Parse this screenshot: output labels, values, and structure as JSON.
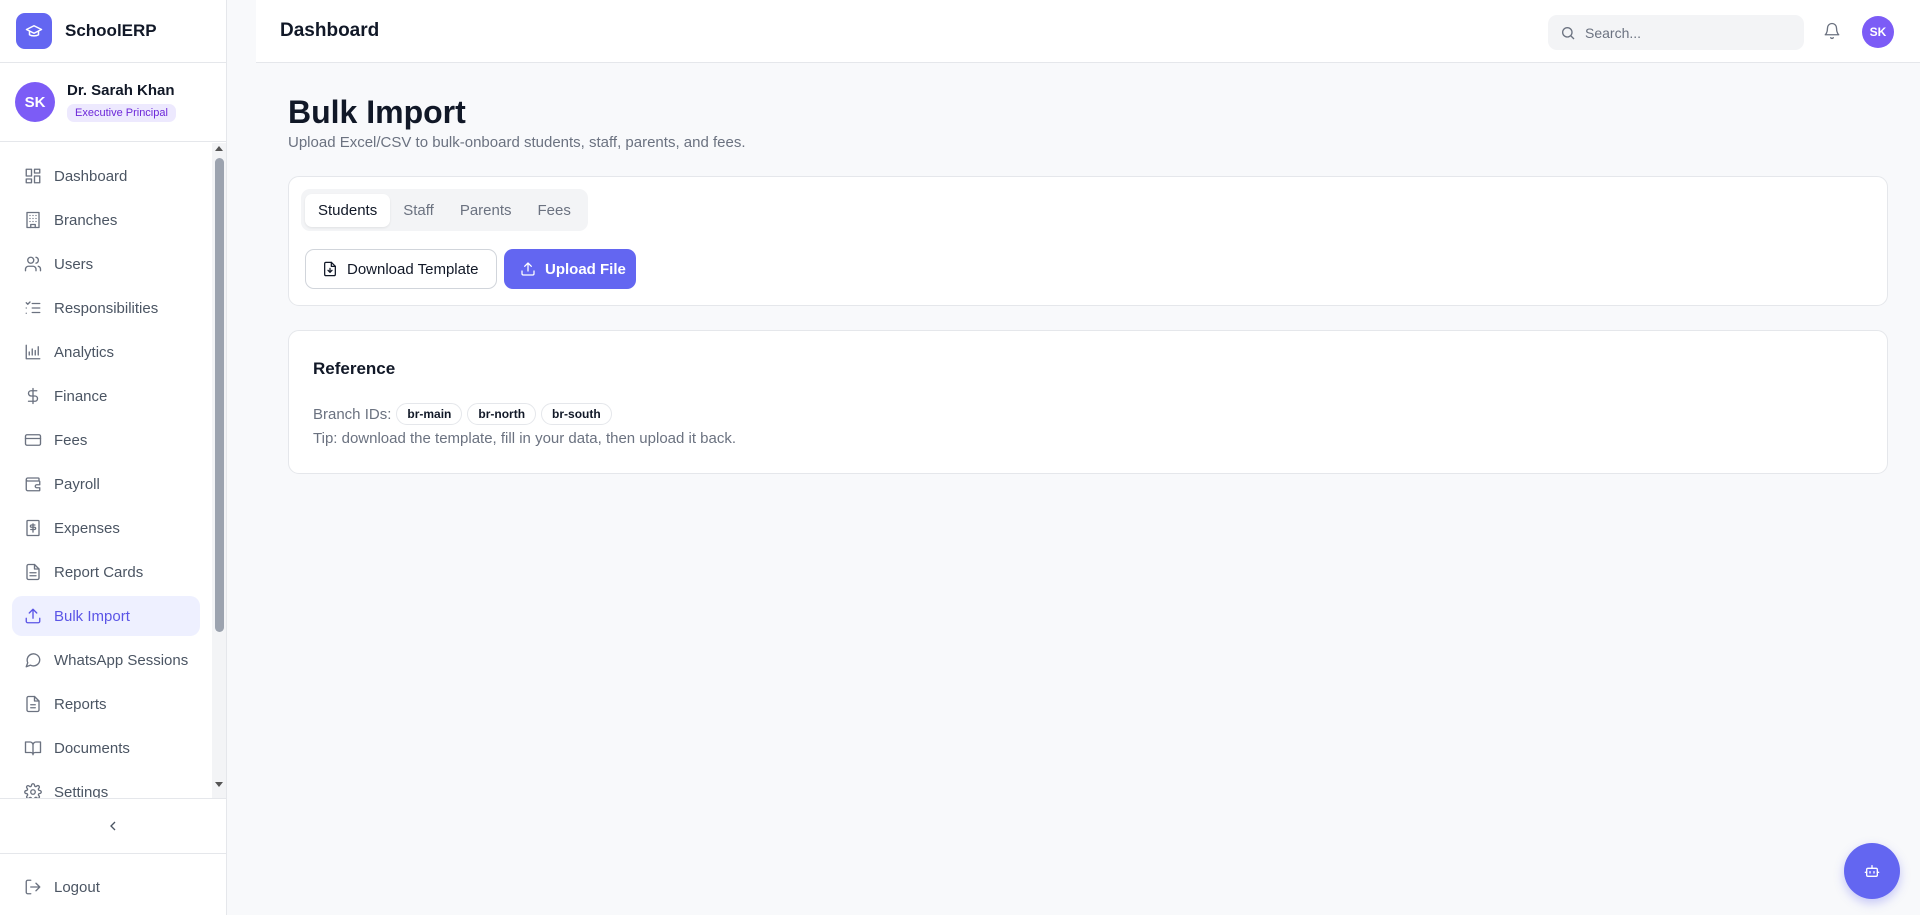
{
  "app": {
    "name": "SchoolERP",
    "logo_icon": "graduation-cap-icon",
    "accent_color": "#6366f1"
  },
  "user": {
    "initials": "SK",
    "name": "Dr. Sarah Khan",
    "role": "Executive Principal"
  },
  "sidebar": {
    "items": [
      {
        "label": "Dashboard",
        "icon": "dashboard-icon"
      },
      {
        "label": "Branches",
        "icon": "building-icon"
      },
      {
        "label": "Users",
        "icon": "users-icon"
      },
      {
        "label": "Responsibilities",
        "icon": "list-check-icon"
      },
      {
        "label": "Analytics",
        "icon": "bar-chart-icon"
      },
      {
        "label": "Finance",
        "icon": "dollar-icon"
      },
      {
        "label": "Fees",
        "icon": "credit-card-icon"
      },
      {
        "label": "Payroll",
        "icon": "wallet-icon"
      },
      {
        "label": "Expenses",
        "icon": "receipt-icon"
      },
      {
        "label": "Report Cards",
        "icon": "file-text-icon"
      },
      {
        "label": "Bulk Import",
        "icon": "upload-icon",
        "active": true
      },
      {
        "label": "WhatsApp Sessions",
        "icon": "message-circle-icon"
      },
      {
        "label": "Reports",
        "icon": "file-icon"
      },
      {
        "label": "Documents",
        "icon": "book-open-icon"
      },
      {
        "label": "Settings",
        "icon": "gear-icon"
      }
    ],
    "logout_label": "Logout"
  },
  "header": {
    "title": "Dashboard",
    "search_placeholder": "Search...",
    "avatar_initials": "SK"
  },
  "page": {
    "title": "Bulk Import",
    "subtitle": "Upload Excel/CSV to bulk-onboard students, staff, parents, and fees."
  },
  "import_card": {
    "tabs": [
      {
        "label": "Students",
        "active": true
      },
      {
        "label": "Staff"
      },
      {
        "label": "Parents"
      },
      {
        "label": "Fees"
      }
    ],
    "download_label": "Download Template",
    "upload_label": "Upload File"
  },
  "reference": {
    "title": "Reference",
    "branch_label": "Branch IDs:",
    "branch_ids": [
      "br-main",
      "br-north",
      "br-south"
    ],
    "tip": "Tip: download the template, fill in your data, then upload it back."
  }
}
